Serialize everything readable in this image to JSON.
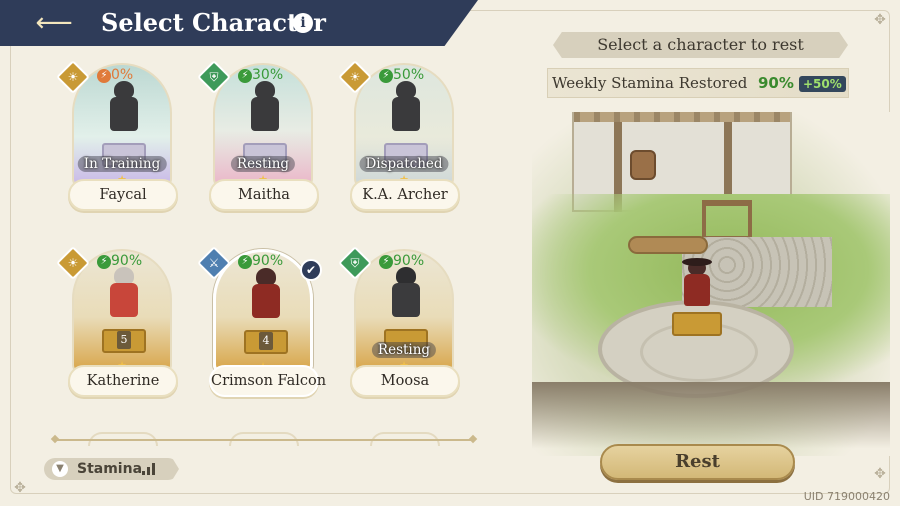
{
  "header": {
    "title": "Select Character",
    "back_icon": "back-arrow-icon",
    "info_glyph": "i"
  },
  "characters": [
    {
      "name": "Faycal",
      "stamina": "0%",
      "status": "In Training",
      "class_icon": "sun-emblem-icon"
    },
    {
      "name": "Maitha",
      "stamina": "30%",
      "status": "Resting",
      "class_icon": "green-shield-emblem-icon"
    },
    {
      "name": "K.A. Archer",
      "stamina": "50%",
      "status": "Dispatched",
      "class_icon": "sun-emblem-icon"
    },
    {
      "name": "Katherine",
      "stamina": "90%",
      "status": "",
      "level": "5",
      "class_icon": "sun-emblem-icon"
    },
    {
      "name": "Crimson Falcon",
      "stamina": "90%",
      "status": "",
      "level": "4",
      "selected": true,
      "class_icon": "crossed-swords-emblem-icon"
    },
    {
      "name": "Moosa",
      "stamina": "90%",
      "status": "Resting",
      "class_icon": "green-shield-emblem-icon"
    }
  ],
  "sort": {
    "label": "Stamina"
  },
  "panel": {
    "title": "Select a character to rest",
    "weekly_label": "Weekly Stamina Restored",
    "weekly_value": "90%",
    "weekly_bonus": "+50%"
  },
  "rest_button": "Rest",
  "uid": "UID 719000420",
  "colors": {
    "header": "#2f3c59",
    "stamina_ok": "#3a9a3a",
    "stamina_low": "#e07a3a",
    "gold": "#c99a35"
  }
}
